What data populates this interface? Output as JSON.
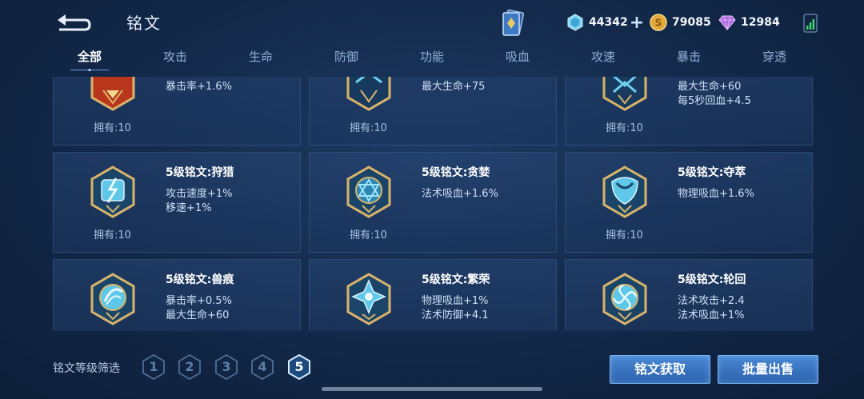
{
  "header": {
    "title": "铭文",
    "currencies": [
      {
        "name": "diamond-crystal",
        "value": "44342"
      },
      {
        "name": "gold-coin",
        "value": "79085"
      },
      {
        "name": "purple-gem",
        "value": "12984"
      }
    ]
  },
  "tabs": [
    {
      "label": "全部",
      "active": true
    },
    {
      "label": "攻击"
    },
    {
      "label": "生命"
    },
    {
      "label": "防御"
    },
    {
      "label": "功能"
    },
    {
      "label": "吸血"
    },
    {
      "label": "攻速"
    },
    {
      "label": "暴击"
    },
    {
      "label": "穿透"
    }
  ],
  "cards": [
    {
      "name": "",
      "attr1": "暴击率+1.6%",
      "attr2": "",
      "owned": "拥有:10",
      "color": "red"
    },
    {
      "name": "",
      "attr1": "最大生命+75",
      "attr2": "",
      "owned": "拥有:10",
      "color": "blue"
    },
    {
      "name": "",
      "attr1": "最大生命+60",
      "attr2": "每5秒回血+4.5",
      "owned": "拥有:10",
      "color": "blue"
    },
    {
      "name": "5级铭文:狩猎",
      "attr1": "攻击速度+1%",
      "attr2": "移速+1%",
      "owned": "拥有:10",
      "color": "blue"
    },
    {
      "name": "5级铭文:贪婪",
      "attr1": "法术吸血+1.6%",
      "attr2": "",
      "owned": "拥有:10",
      "color": "blue"
    },
    {
      "name": "5级铭文:夺萃",
      "attr1": "物理吸血+1.6%",
      "attr2": "",
      "owned": "拥有:10",
      "color": "blue"
    },
    {
      "name": "5级铭文:兽痕",
      "attr1": "暴击率+0.5%",
      "attr2": "最大生命+60",
      "owned": "",
      "color": "blue"
    },
    {
      "name": "5级铭文:繁荣",
      "attr1": "物理吸血+1%",
      "attr2": "法术防御+4.1",
      "owned": "",
      "color": "blue"
    },
    {
      "name": "5级铭文:轮回",
      "attr1": "法术攻击+2.4",
      "attr2": "法术吸血+1%",
      "owned": "",
      "color": "blue"
    }
  ],
  "filter": {
    "label": "铭文等级筛选",
    "levels": [
      "1",
      "2",
      "3",
      "4",
      "5"
    ],
    "selected": "5"
  },
  "buttons": {
    "obtain": "铭文获取",
    "bulk_sell": "批量出售"
  },
  "colors": {
    "accent": "#4a88d4",
    "gold": "#c9a45a",
    "rune_blue": "#5fc8e8",
    "rune_red": "#c8452a"
  }
}
